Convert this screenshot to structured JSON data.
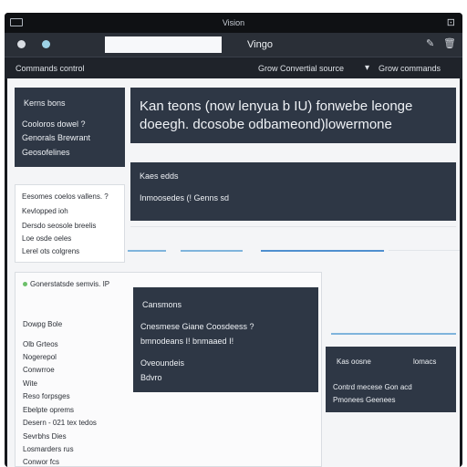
{
  "window": {
    "title": "Vision",
    "close_icon": "close-square-icon"
  },
  "toolbar": {
    "search_value": "",
    "app_label": "Vingo",
    "icons": [
      "circle-icon",
      "circle-icon",
      "pen-icon",
      "trash-icon"
    ]
  },
  "menubar": {
    "left_label": "Commands control",
    "mid_label": "Grow Convertial source",
    "right_label": "Grow commands",
    "caret": "▾"
  },
  "panels": {
    "left_top": {
      "heading": "Kerns bons",
      "items": [
        "Cooloros dowel ?",
        "Genorals Brewrant",
        "Geosofelines"
      ]
    },
    "main_header": {
      "line1": "Kan teons (now lenyua b IU) fonwebe leonge",
      "line2": "doeegh. dcosobe odbameond)lowermone"
    },
    "info_card": {
      "title": "Kaes edds",
      "line": "Inmoosedes (! Genns sd"
    },
    "left_mid": {
      "lines": [
        "Eesomes coelos vallens. ?",
        "Kevlopped ioh",
        "Dersdo seosole breelis",
        "Loe osde oeles",
        "Lerel ots colgrens"
      ]
    },
    "section": {
      "title": "Gonerstatsde semvis. IP",
      "label": "Dowpg Bole",
      "items": [
        "Olb Grteos",
        "Nogerepol",
        "Conwrroe",
        "Wite",
        "Reso forpsges",
        "Ebelpte oprems",
        "Desern - 021 tex tedos",
        "Sevrbhs Dies",
        "Losmarders rus",
        "Conwor fcs"
      ]
    },
    "dark_center": {
      "title": "Cansmons",
      "row1": "Cnesmese Giane Coosdeess ?",
      "row2": "bmnodeans I! bnmaaed I!",
      "row3": "Oveoundeis",
      "row4": "Bdvro"
    },
    "small_card": {
      "title": "Kas oosne",
      "right": "lomacs",
      "line1": "Contrd mecese Gon acd",
      "line2": "Pmonees Geenees"
    }
  }
}
